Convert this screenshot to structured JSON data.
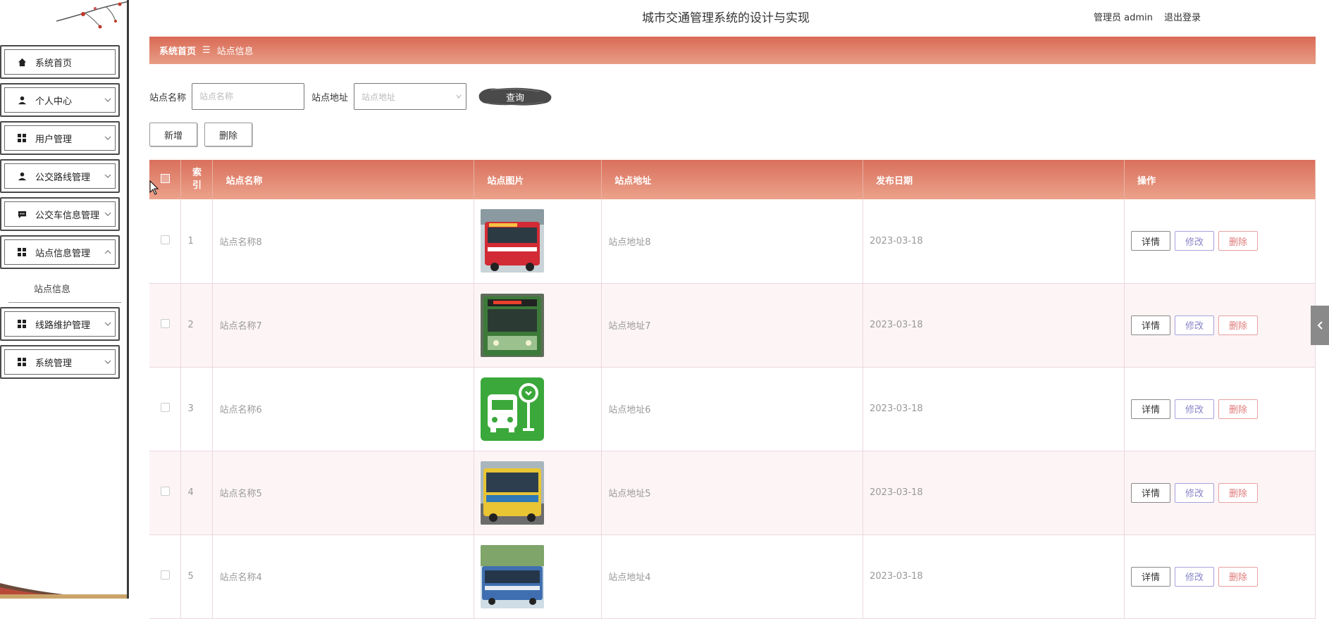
{
  "header": {
    "title": "城市交通管理系统的设计与实现",
    "user_label": "管理员 admin",
    "logout": "退出登录"
  },
  "sidebar": {
    "items": [
      {
        "label": "系统首页",
        "icon": "home-icon",
        "expandable": false
      },
      {
        "label": "个人中心",
        "icon": "person-icon",
        "expandable": true
      },
      {
        "label": "用户管理",
        "icon": "grid-icon",
        "expandable": true
      },
      {
        "label": "公交路线管理",
        "icon": "person-icon",
        "expandable": true
      },
      {
        "label": "公交车信息管理",
        "icon": "chat-icon",
        "expandable": true
      },
      {
        "label": "站点信息管理",
        "icon": "grid-icon",
        "expandable": true,
        "expanded": true
      },
      {
        "label": "线路维护管理",
        "icon": "grid-icon",
        "expandable": true
      },
      {
        "label": "系统管理",
        "icon": "grid-icon",
        "expandable": true
      }
    ],
    "submenu": {
      "label": "站点信息"
    }
  },
  "breadcrumb": {
    "home": "系统首页",
    "separator": "☰",
    "current": "站点信息"
  },
  "search": {
    "name_label": "站点名称",
    "name_placeholder": "站点名称",
    "address_label": "站点地址",
    "address_placeholder": "站点地址",
    "query_label": "查询"
  },
  "actions": {
    "add_label": "新增",
    "delete_label": "删除"
  },
  "table": {
    "columns": [
      "",
      "索引",
      "站点名称",
      "站点图片",
      "站点地址",
      "发布日期",
      "操作"
    ],
    "index_header_line1": "索",
    "index_header_line2": "引",
    "rows": [
      {
        "index": "1",
        "name": "站点名称8",
        "image": "red-bus-photo",
        "address": "站点地址8",
        "date": "2023-03-18"
      },
      {
        "index": "2",
        "name": "站点名称7",
        "image": "green-bus-photo",
        "address": "站点地址7",
        "date": "2023-03-18"
      },
      {
        "index": "3",
        "name": "站点名称6",
        "image": "bus-stop-icon-image",
        "address": "站点地址6",
        "date": "2023-03-18"
      },
      {
        "index": "4",
        "name": "站点名称5",
        "image": "yellow-bus-photo",
        "address": "站点地址5",
        "date": "2023-03-18"
      },
      {
        "index": "5",
        "name": "站点名称4",
        "image": "blue-bus-photo",
        "address": "站点地址4",
        "date": "2023-03-18"
      }
    ],
    "op_detail": "详情",
    "op_edit": "修改",
    "op_delete": "删除"
  },
  "colors": {
    "accent": "#d96a56",
    "accent_light": "#eca28b",
    "edit": "#8a86c8",
    "delete": "#e07a7a"
  }
}
